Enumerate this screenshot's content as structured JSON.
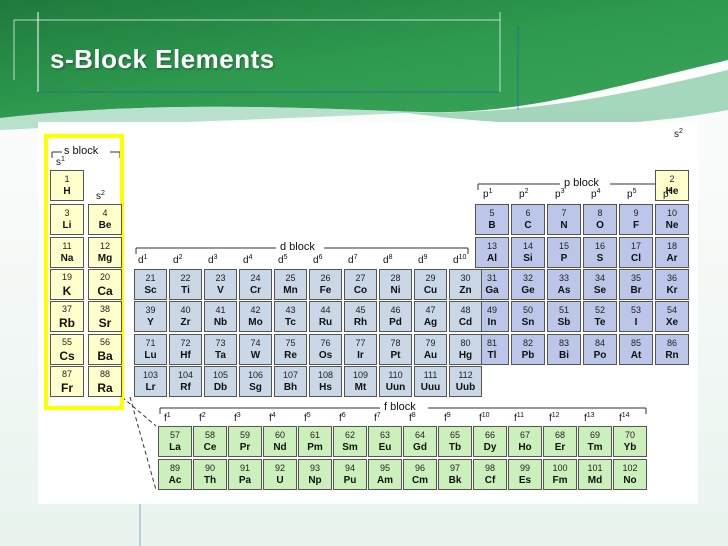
{
  "slide": {
    "title": "s-Block Elements"
  },
  "colors": {
    "s_block": "#ffffcc",
    "p_block": "#bcc6e8",
    "d_block": "#c9d7e6",
    "f_block": "#ccf0bb",
    "highlight": "#ffff00",
    "bg_green": "#2e8a4d"
  },
  "block_labels": {
    "s": "s block",
    "p": "p block",
    "d": "d block",
    "f": "f block"
  },
  "config_labels": {
    "s": [
      "s",
      "s"
    ],
    "s_sup": [
      "1",
      "2"
    ],
    "p": [
      "p",
      "p",
      "p",
      "p",
      "p",
      "p"
    ],
    "p_sup": [
      "1",
      "2",
      "3",
      "4",
      "5",
      "6"
    ],
    "d": [
      "d",
      "d",
      "d",
      "d",
      "d",
      "d",
      "d",
      "d",
      "d",
      "d"
    ],
    "d_sup": [
      "1",
      "2",
      "3",
      "4",
      "5",
      "6",
      "7",
      "8",
      "9",
      "10"
    ],
    "f": [
      "f",
      "f",
      "f",
      "f",
      "f",
      "f",
      "f",
      "f",
      "f",
      "f",
      "f",
      "f",
      "f",
      "f"
    ],
    "f_sup": [
      "1",
      "2",
      "3",
      "4",
      "5",
      "6",
      "7",
      "8",
      "9",
      "10",
      "11",
      "12",
      "13",
      "14"
    ],
    "he_s": "s",
    "he_sup": "2"
  },
  "elements": [
    {
      "n": "1",
      "s": "H",
      "b": "s",
      "c": 0,
      "r": 0
    },
    {
      "n": "3",
      "s": "Li",
      "b": "s",
      "c": 0,
      "r": 1
    },
    {
      "n": "4",
      "s": "Be",
      "b": "s",
      "c": 1,
      "r": 1
    },
    {
      "n": "11",
      "s": "Na",
      "b": "s",
      "c": 0,
      "r": 2
    },
    {
      "n": "12",
      "s": "Mg",
      "b": "s",
      "c": 1,
      "r": 2
    },
    {
      "n": "19",
      "s": "K",
      "b": "s",
      "c": 0,
      "r": 3
    },
    {
      "n": "20",
      "s": "Ca",
      "b": "s",
      "c": 1,
      "r": 3
    },
    {
      "n": "37",
      "s": "Rb",
      "b": "s",
      "c": 0,
      "r": 4
    },
    {
      "n": "38",
      "s": "Sr",
      "b": "s",
      "c": 1,
      "r": 4
    },
    {
      "n": "55",
      "s": "Cs",
      "b": "s",
      "c": 0,
      "r": 5
    },
    {
      "n": "56",
      "s": "Ba",
      "b": "s",
      "c": 1,
      "r": 5
    },
    {
      "n": "87",
      "s": "Fr",
      "b": "s",
      "c": 0,
      "r": 6
    },
    {
      "n": "88",
      "s": "Ra",
      "b": "s",
      "c": 1,
      "r": 6
    },
    {
      "n": "2",
      "s": "He",
      "b": "s",
      "c": 17,
      "r": 0
    },
    {
      "n": "5",
      "s": "B",
      "b": "p",
      "c": 12,
      "r": 1
    },
    {
      "n": "6",
      "s": "C",
      "b": "p",
      "c": 13,
      "r": 1
    },
    {
      "n": "7",
      "s": "N",
      "b": "p",
      "c": 14,
      "r": 1
    },
    {
      "n": "8",
      "s": "O",
      "b": "p",
      "c": 15,
      "r": 1
    },
    {
      "n": "9",
      "s": "F",
      "b": "p",
      "c": 16,
      "r": 1
    },
    {
      "n": "10",
      "s": "Ne",
      "b": "p",
      "c": 17,
      "r": 1
    },
    {
      "n": "13",
      "s": "Al",
      "b": "p",
      "c": 12,
      "r": 2
    },
    {
      "n": "14",
      "s": "Si",
      "b": "p",
      "c": 13,
      "r": 2
    },
    {
      "n": "15",
      "s": "P",
      "b": "p",
      "c": 14,
      "r": 2
    },
    {
      "n": "16",
      "s": "S",
      "b": "p",
      "c": 15,
      "r": 2
    },
    {
      "n": "17",
      "s": "Cl",
      "b": "p",
      "c": 16,
      "r": 2
    },
    {
      "n": "18",
      "s": "Ar",
      "b": "p",
      "c": 17,
      "r": 2
    },
    {
      "n": "31",
      "s": "Ga",
      "b": "p",
      "c": 12,
      "r": 3
    },
    {
      "n": "32",
      "s": "Ge",
      "b": "p",
      "c": 13,
      "r": 3
    },
    {
      "n": "33",
      "s": "As",
      "b": "p",
      "c": 14,
      "r": 3
    },
    {
      "n": "34",
      "s": "Se",
      "b": "p",
      "c": 15,
      "r": 3
    },
    {
      "n": "35",
      "s": "Br",
      "b": "p",
      "c": 16,
      "r": 3
    },
    {
      "n": "36",
      "s": "Kr",
      "b": "p",
      "c": 17,
      "r": 3
    },
    {
      "n": "49",
      "s": "In",
      "b": "p",
      "c": 12,
      "r": 4
    },
    {
      "n": "50",
      "s": "Sn",
      "b": "p",
      "c": 13,
      "r": 4
    },
    {
      "n": "51",
      "s": "Sb",
      "b": "p",
      "c": 14,
      "r": 4
    },
    {
      "n": "52",
      "s": "Te",
      "b": "p",
      "c": 15,
      "r": 4
    },
    {
      "n": "53",
      "s": "I",
      "b": "p",
      "c": 16,
      "r": 4
    },
    {
      "n": "54",
      "s": "Xe",
      "b": "p",
      "c": 17,
      "r": 4
    },
    {
      "n": "81",
      "s": "Tl",
      "b": "p",
      "c": 12,
      "r": 5
    },
    {
      "n": "82",
      "s": "Pb",
      "b": "p",
      "c": 13,
      "r": 5
    },
    {
      "n": "83",
      "s": "Bi",
      "b": "p",
      "c": 14,
      "r": 5
    },
    {
      "n": "84",
      "s": "Po",
      "b": "p",
      "c": 15,
      "r": 5
    },
    {
      "n": "85",
      "s": "At",
      "b": "p",
      "c": 16,
      "r": 5
    },
    {
      "n": "86",
      "s": "Rn",
      "b": "p",
      "c": 17,
      "r": 5
    },
    {
      "n": "21",
      "s": "Sc",
      "b": "d",
      "c": 2,
      "r": 3
    },
    {
      "n": "22",
      "s": "Ti",
      "b": "d",
      "c": 3,
      "r": 3
    },
    {
      "n": "23",
      "s": "V",
      "b": "d",
      "c": 4,
      "r": 3
    },
    {
      "n": "24",
      "s": "Cr",
      "b": "d",
      "c": 5,
      "r": 3
    },
    {
      "n": "25",
      "s": "Mn",
      "b": "d",
      "c": 6,
      "r": 3
    },
    {
      "n": "26",
      "s": "Fe",
      "b": "d",
      "c": 7,
      "r": 3
    },
    {
      "n": "27",
      "s": "Co",
      "b": "d",
      "c": 8,
      "r": 3
    },
    {
      "n": "28",
      "s": "Ni",
      "b": "d",
      "c": 9,
      "r": 3
    },
    {
      "n": "29",
      "s": "Cu",
      "b": "d",
      "c": 10,
      "r": 3
    },
    {
      "n": "30",
      "s": "Zn",
      "b": "d",
      "c": 11,
      "r": 3
    },
    {
      "n": "39",
      "s": "Y",
      "b": "d",
      "c": 2,
      "r": 4
    },
    {
      "n": "40",
      "s": "Zr",
      "b": "d",
      "c": 3,
      "r": 4
    },
    {
      "n": "41",
      "s": "Nb",
      "b": "d",
      "c": 4,
      "r": 4
    },
    {
      "n": "42",
      "s": "Mo",
      "b": "d",
      "c": 5,
      "r": 4
    },
    {
      "n": "43",
      "s": "Tc",
      "b": "d",
      "c": 6,
      "r": 4
    },
    {
      "n": "44",
      "s": "Ru",
      "b": "d",
      "c": 7,
      "r": 4
    },
    {
      "n": "45",
      "s": "Rh",
      "b": "d",
      "c": 8,
      "r": 4
    },
    {
      "n": "46",
      "s": "Pd",
      "b": "d",
      "c": 9,
      "r": 4
    },
    {
      "n": "47",
      "s": "Ag",
      "b": "d",
      "c": 10,
      "r": 4
    },
    {
      "n": "48",
      "s": "Cd",
      "b": "d",
      "c": 11,
      "r": 4
    },
    {
      "n": "71",
      "s": "Lu",
      "b": "d",
      "c": 2,
      "r": 5
    },
    {
      "n": "72",
      "s": "Hf",
      "b": "d",
      "c": 3,
      "r": 5
    },
    {
      "n": "73",
      "s": "Ta",
      "b": "d",
      "c": 4,
      "r": 5
    },
    {
      "n": "74",
      "s": "W",
      "b": "d",
      "c": 5,
      "r": 5
    },
    {
      "n": "75",
      "s": "Re",
      "b": "d",
      "c": 6,
      "r": 5
    },
    {
      "n": "76",
      "s": "Os",
      "b": "d",
      "c": 7,
      "r": 5
    },
    {
      "n": "77",
      "s": "Ir",
      "b": "d",
      "c": 8,
      "r": 5
    },
    {
      "n": "78",
      "s": "Pt",
      "b": "d",
      "c": 9,
      "r": 5
    },
    {
      "n": "79",
      "s": "Au",
      "b": "d",
      "c": 10,
      "r": 5
    },
    {
      "n": "80",
      "s": "Hg",
      "b": "d",
      "c": 11,
      "r": 5
    },
    {
      "n": "103",
      "s": "Lr",
      "b": "d",
      "c": 2,
      "r": 6
    },
    {
      "n": "104",
      "s": "Rf",
      "b": "d",
      "c": 3,
      "r": 6
    },
    {
      "n": "105",
      "s": "Db",
      "b": "d",
      "c": 4,
      "r": 6
    },
    {
      "n": "106",
      "s": "Sg",
      "b": "d",
      "c": 5,
      "r": 6
    },
    {
      "n": "107",
      "s": "Bh",
      "b": "d",
      "c": 6,
      "r": 6
    },
    {
      "n": "108",
      "s": "Hs",
      "b": "d",
      "c": 7,
      "r": 6
    },
    {
      "n": "109",
      "s": "Mt",
      "b": "d",
      "c": 8,
      "r": 6
    },
    {
      "n": "110",
      "s": "Uun",
      "b": "d",
      "c": 9,
      "r": 6
    },
    {
      "n": "111",
      "s": "Uuu",
      "b": "d",
      "c": 10,
      "r": 6
    },
    {
      "n": "112",
      "s": "Uub",
      "b": "d",
      "c": 11,
      "r": 6
    }
  ],
  "f_elements": [
    [
      {
        "n": "57",
        "s": "La"
      },
      {
        "n": "58",
        "s": "Ce"
      },
      {
        "n": "59",
        "s": "Pr"
      },
      {
        "n": "60",
        "s": "Nd"
      },
      {
        "n": "61",
        "s": "Pm"
      },
      {
        "n": "62",
        "s": "Sm"
      },
      {
        "n": "63",
        "s": "Eu"
      },
      {
        "n": "64",
        "s": "Gd"
      },
      {
        "n": "65",
        "s": "Tb"
      },
      {
        "n": "66",
        "s": "Dy"
      },
      {
        "n": "67",
        "s": "Ho"
      },
      {
        "n": "68",
        "s": "Er"
      },
      {
        "n": "69",
        "s": "Tm"
      },
      {
        "n": "70",
        "s": "Yb"
      }
    ],
    [
      {
        "n": "89",
        "s": "Ac"
      },
      {
        "n": "90",
        "s": "Th"
      },
      {
        "n": "91",
        "s": "Pa"
      },
      {
        "n": "92",
        "s": "U"
      },
      {
        "n": "93",
        "s": "Np"
      },
      {
        "n": "94",
        "s": "Pu"
      },
      {
        "n": "95",
        "s": "Am"
      },
      {
        "n": "96",
        "s": "Cm"
      },
      {
        "n": "97",
        "s": "Bk"
      },
      {
        "n": "98",
        "s": "Cf"
      },
      {
        "n": "99",
        "s": "Es"
      },
      {
        "n": "100",
        "s": "Fm"
      },
      {
        "n": "101",
        "s": "Md"
      },
      {
        "n": "102",
        "s": "No"
      }
    ]
  ]
}
